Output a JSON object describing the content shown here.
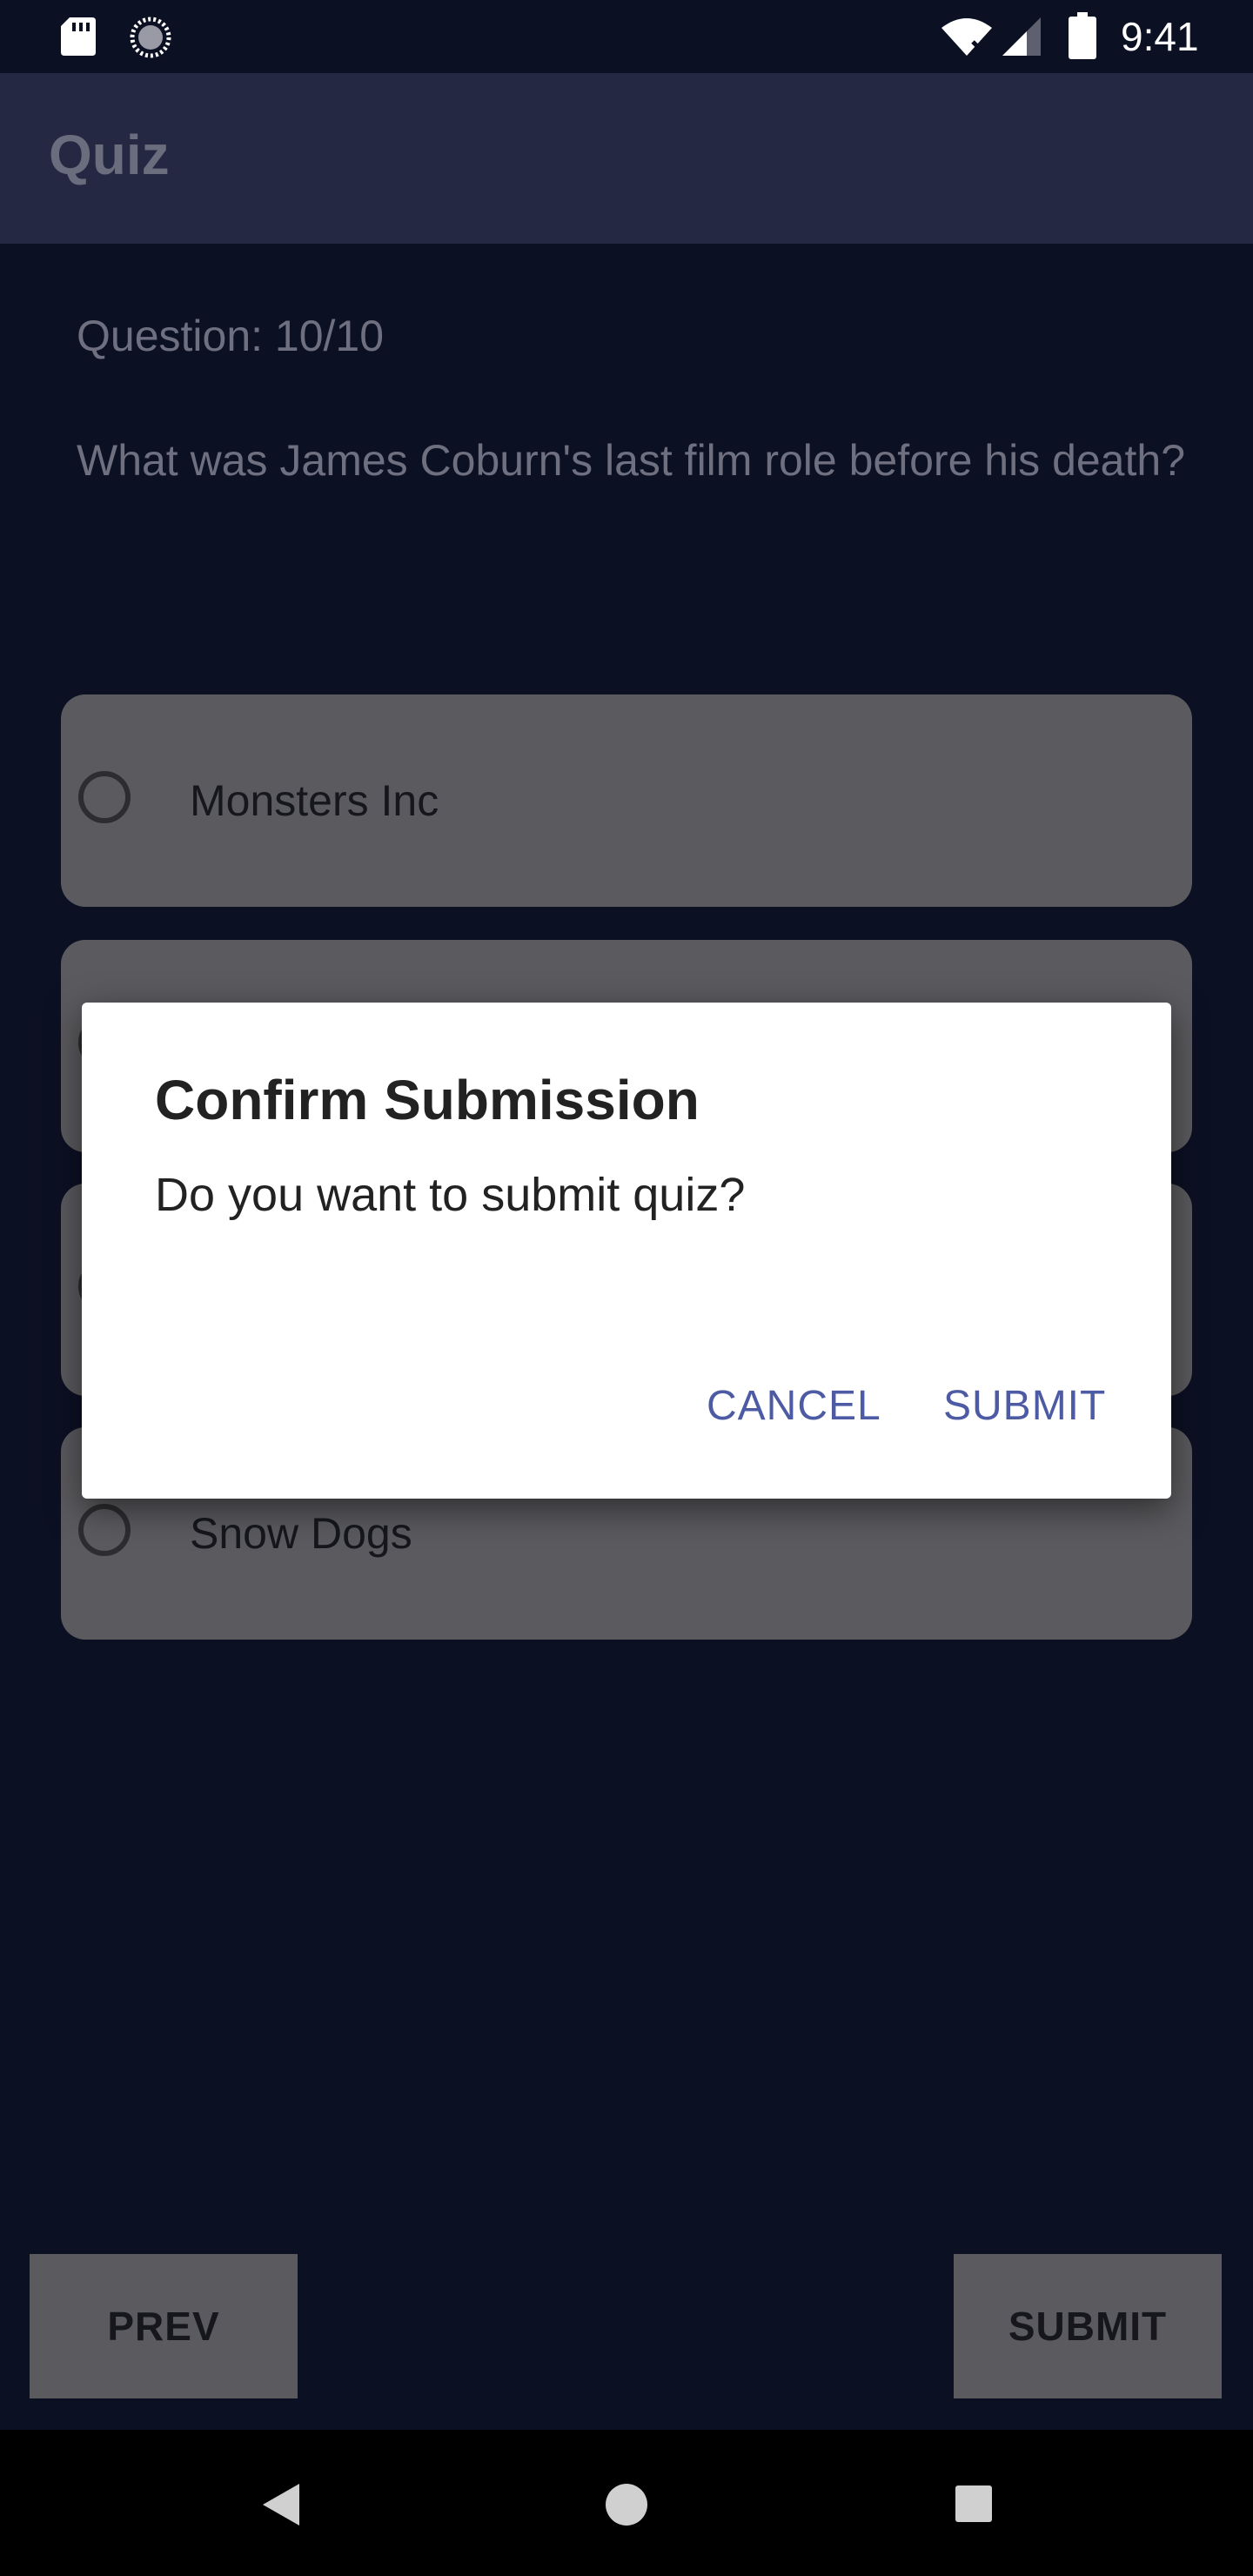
{
  "status_bar": {
    "time": "9:41",
    "icons": [
      "sd-card-icon",
      "sync-icon",
      "wifi-icon",
      "signal-icon",
      "battery-icon"
    ]
  },
  "app_bar": {
    "title": "Quiz"
  },
  "quiz": {
    "counter": "Question: 10/10",
    "question": "What was James Coburn's last film role before his death?",
    "options": [
      {
        "label": "Monsters Inc"
      },
      {
        "label": ""
      },
      {
        "label": ""
      },
      {
        "label": "Snow Dogs"
      }
    ]
  },
  "footer": {
    "prev_label": "PREV",
    "submit_label": "SUBMIT"
  },
  "dialog": {
    "title": "Confirm Submission",
    "message": "Do you want to submit quiz?",
    "cancel_label": "CANCEL",
    "submit_label": "SUBMIT"
  },
  "nav_bar": {
    "icons": [
      "back-icon",
      "home-icon",
      "recents-icon"
    ]
  },
  "colors": {
    "background": "#0c1023",
    "app_bar": "#252843",
    "option_card": "#5b5b5f",
    "dialog_accent": "#4d5aa4"
  }
}
